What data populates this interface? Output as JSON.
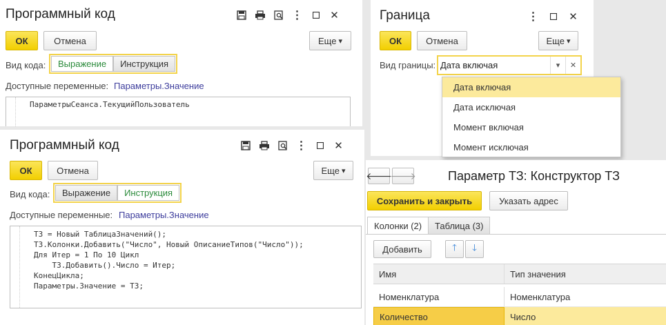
{
  "w1": {
    "title": "Программный код",
    "ok": "ОК",
    "cancel": "Отмена",
    "more": "Еще",
    "code_kind_label": "Вид кода:",
    "seg_expression": "Выражение",
    "seg_instruction": "Инструкция",
    "vars_label": "Доступные переменные:",
    "vars_link": "Параметры.Значение",
    "code": "ПараметрыСеанса.ТекущийПользователь"
  },
  "w2": {
    "title": "Программный код",
    "ok": "ОК",
    "cancel": "Отмена",
    "more": "Еще",
    "code_kind_label": "Вид кода:",
    "seg_expression": "Выражение",
    "seg_instruction": "Инструкция",
    "vars_label": "Доступные переменные:",
    "vars_link": "Параметры.Значение",
    "code": "ТЗ = Новый ТаблицаЗначений();\nТЗ.Колонки.Добавить(\"Число\", Новый ОписаниеТипов(\"Число\"));\nДля Итер = 1 По 10 Цикл\n    ТЗ.Добавить().Число = Итер;\nКонецЦикла;\nПараметры.Значение = ТЗ;"
  },
  "w3": {
    "title": "Граница",
    "ok": "ОК",
    "cancel": "Отмена",
    "more": "Еще",
    "boundary_label": "Вид границы:",
    "boundary_value": "Дата включая",
    "options": [
      "Дата включая",
      "Дата исключая",
      "Момент включая",
      "Момент исключая"
    ]
  },
  "w4": {
    "title": "Параметр ТЗ: Конструктор ТЗ",
    "save_close": "Сохранить и закрыть",
    "set_address": "Указать адрес",
    "tab_columns": "Колонки (2)",
    "tab_table": "Таблица (3)",
    "add": "Добавить",
    "col_name": "Имя",
    "col_type": "Тип значения",
    "rows": [
      {
        "name": "Номенклатура",
        "type": "Номенклатура"
      },
      {
        "name": "Количество",
        "type": "Число"
      }
    ]
  },
  "colors": {
    "accent": "#f2cf00",
    "highlight": "#fcea9c",
    "active_text": "#2a8a3a",
    "link": "#3c3c9c"
  },
  "icons": [
    "save-icon",
    "print-icon",
    "preview-icon",
    "more-vert-icon",
    "maximize-icon",
    "close-icon",
    "arrow-left-icon",
    "arrow-right-icon",
    "arrow-up-icon",
    "arrow-down-icon",
    "dropdown-icon",
    "clear-icon"
  ]
}
